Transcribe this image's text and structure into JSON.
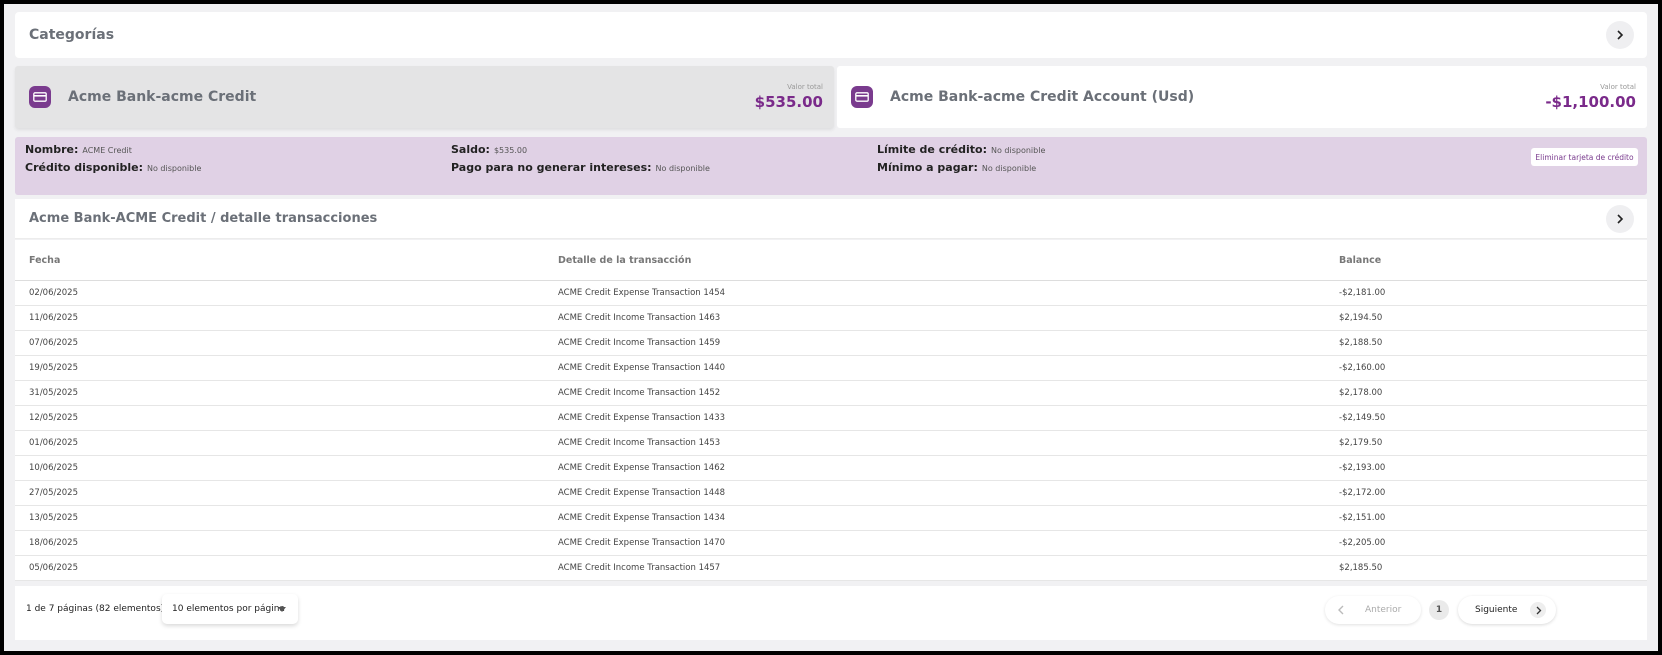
{
  "categories": {
    "title": "Categorías"
  },
  "accounts": [
    {
      "name": "Acme Bank-acme Credit",
      "label": "Valor total",
      "value": "$535.00"
    },
    {
      "name": "Acme Bank-acme Credit Account (Usd)",
      "label": "Valor total",
      "value": "-$1,100.00"
    }
  ],
  "details": {
    "nombre_label": "Nombre:",
    "nombre_value": "ACME Credit",
    "credito_label": "Crédito disponible:",
    "credito_value": "No disponible",
    "saldo_label": "Saldo:",
    "saldo_value": "$535.00",
    "pago_label": "Pago para no generar intereses:",
    "pago_value": "No disponible",
    "limite_label": "Límite de crédito:",
    "limite_value": "No disponible",
    "minimo_label": "Mínimo a pagar:",
    "minimo_value": "No disponible",
    "delete_button": "Eliminar tarjeta de crédito"
  },
  "transactions": {
    "title": "Acme Bank-ACME Credit / detalle transacciones",
    "columns": [
      "Fecha",
      "Detalle de la transacción",
      "Balance"
    ],
    "rows": [
      [
        "02/06/2025",
        "ACME Credit Expense Transaction 1454",
        "-$2,181.00"
      ],
      [
        "11/06/2025",
        "ACME Credit Income Transaction 1463",
        "$2,194.50"
      ],
      [
        "07/06/2025",
        "ACME Credit Income Transaction 1459",
        "$2,188.50"
      ],
      [
        "19/05/2025",
        "ACME Credit Expense Transaction 1440",
        "-$2,160.00"
      ],
      [
        "31/05/2025",
        "ACME Credit Income Transaction 1452",
        "$2,178.00"
      ],
      [
        "12/05/2025",
        "ACME Credit Expense Transaction 1433",
        "-$2,149.50"
      ],
      [
        "01/06/2025",
        "ACME Credit Income Transaction 1453",
        "$2,179.50"
      ],
      [
        "10/06/2025",
        "ACME Credit Expense Transaction 1462",
        "-$2,193.00"
      ],
      [
        "27/05/2025",
        "ACME Credit Expense Transaction 1448",
        "-$2,172.00"
      ],
      [
        "13/05/2025",
        "ACME Credit Expense Transaction 1434",
        "-$2,151.00"
      ],
      [
        "18/06/2025",
        "ACME Credit Expense Transaction 1470",
        "-$2,205.00"
      ],
      [
        "05/06/2025",
        "ACME Credit Income Transaction 1457",
        "$2,185.50"
      ]
    ]
  },
  "pagination": {
    "info": "1 de 7 páginas (82 elementos)",
    "page_size": "10 elementos por página",
    "prev": "Anterior",
    "page": "1",
    "next": "Siguiente"
  },
  "icons": {
    "card": "credit-card-icon",
    "chevron": "chevron-right-icon"
  },
  "colors": {
    "accent": "#7a2a8a",
    "details_bg": "#e0d1e5"
  }
}
